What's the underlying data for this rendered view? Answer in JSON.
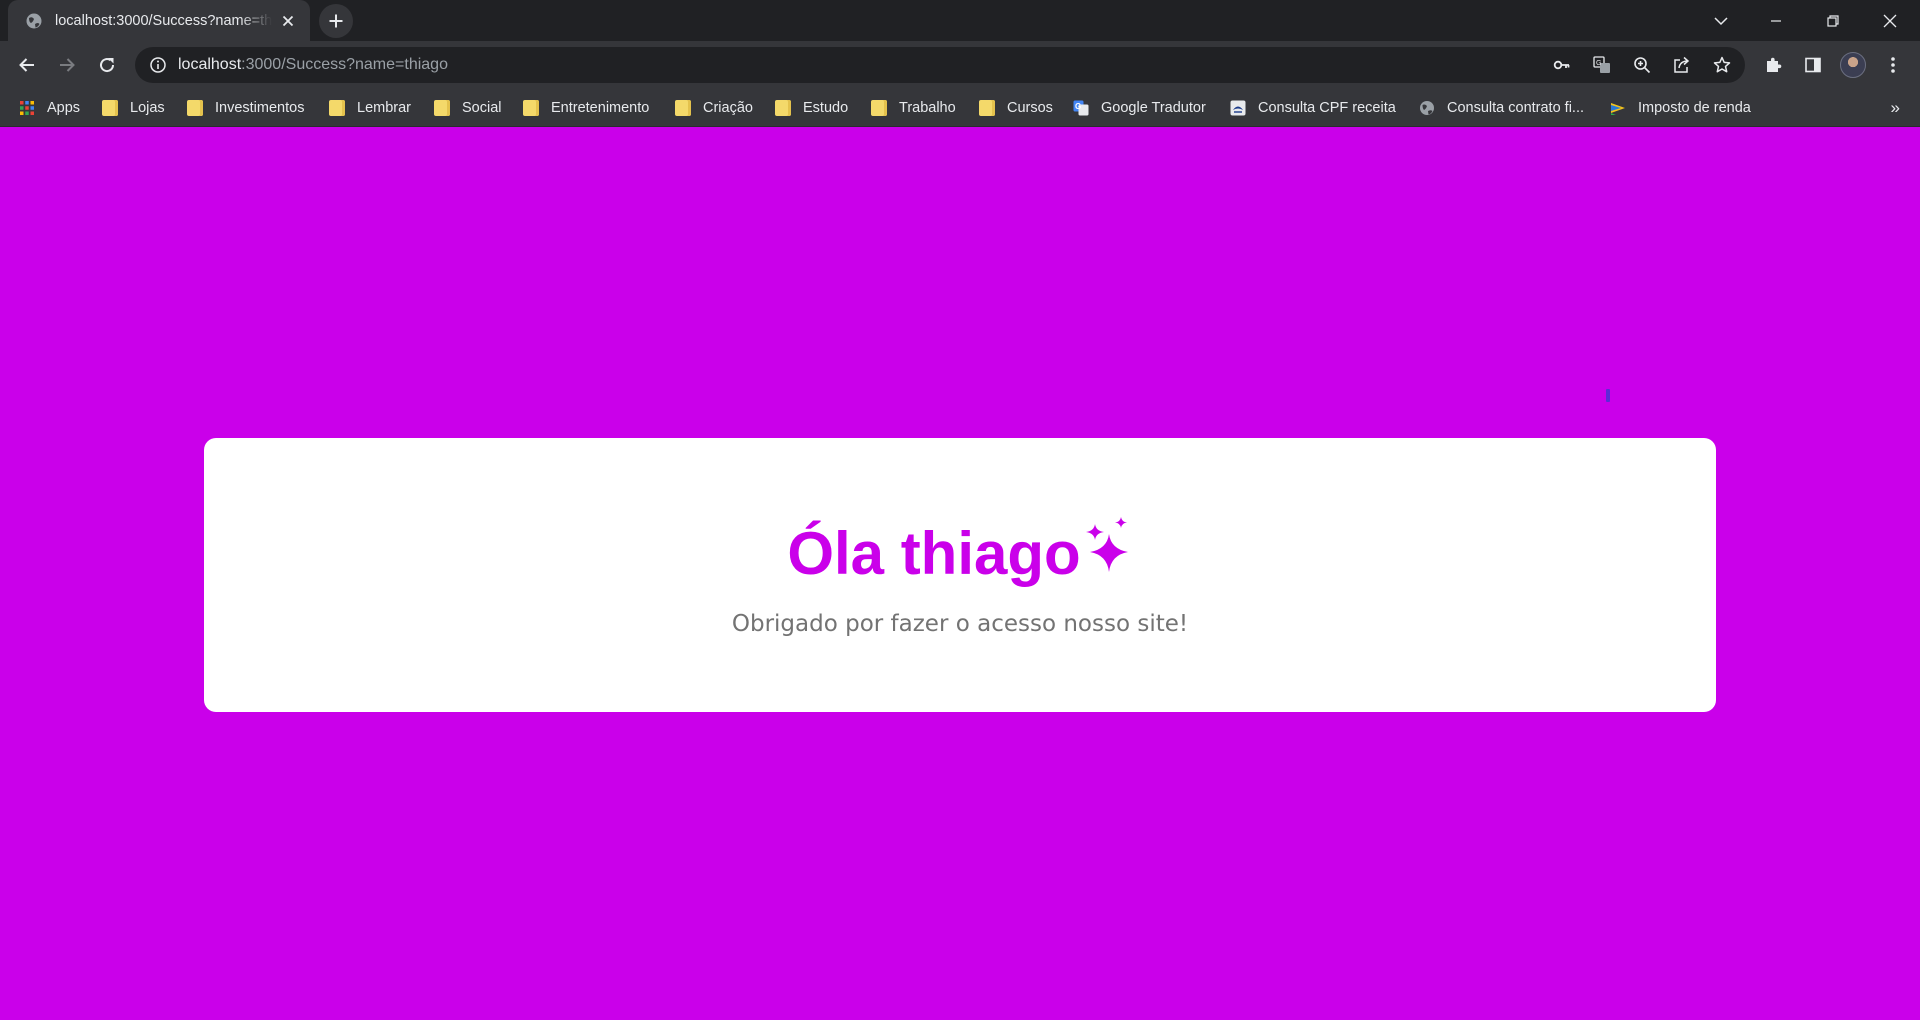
{
  "browser": {
    "tab": {
      "title": "localhost:3000/Success?name=thiago"
    },
    "address": {
      "host": "localhost",
      "path": ":3000/Success?name=thiago"
    },
    "bookmarks": [
      {
        "label": "Apps",
        "icon": "apps-grid-icon"
      },
      {
        "label": "Lojas",
        "icon": "folder-icon"
      },
      {
        "label": "Investimentos",
        "icon": "folder-icon"
      },
      {
        "label": "Lembrar",
        "icon": "folder-icon"
      },
      {
        "label": "Social",
        "icon": "folder-icon"
      },
      {
        "label": "Entretenimento",
        "icon": "folder-icon"
      },
      {
        "label": "Criação",
        "icon": "folder-icon"
      },
      {
        "label": "Estudo",
        "icon": "folder-icon"
      },
      {
        "label": "Trabalho",
        "icon": "folder-icon"
      },
      {
        "label": "Cursos",
        "icon": "folder-icon"
      },
      {
        "label": "Google Tradutor",
        "icon": "google-translate-icon"
      },
      {
        "label": "Consulta CPF receita",
        "icon": "receita-icon"
      },
      {
        "label": "Consulta contrato fi...",
        "icon": "globe-icon"
      },
      {
        "label": "Imposto de renda",
        "icon": "gov-flag-icon"
      }
    ],
    "bookmarks_overflow": "»"
  },
  "page": {
    "heading": "Óla thiago",
    "heading_icon": "sparkles-icon",
    "subtitle": "Obrigado por fazer o acesso nosso site!",
    "colors": {
      "background": "#CA00EA",
      "card": "#FFFFFF",
      "heading": "#CA00EA",
      "subtitle": "#737373"
    }
  }
}
